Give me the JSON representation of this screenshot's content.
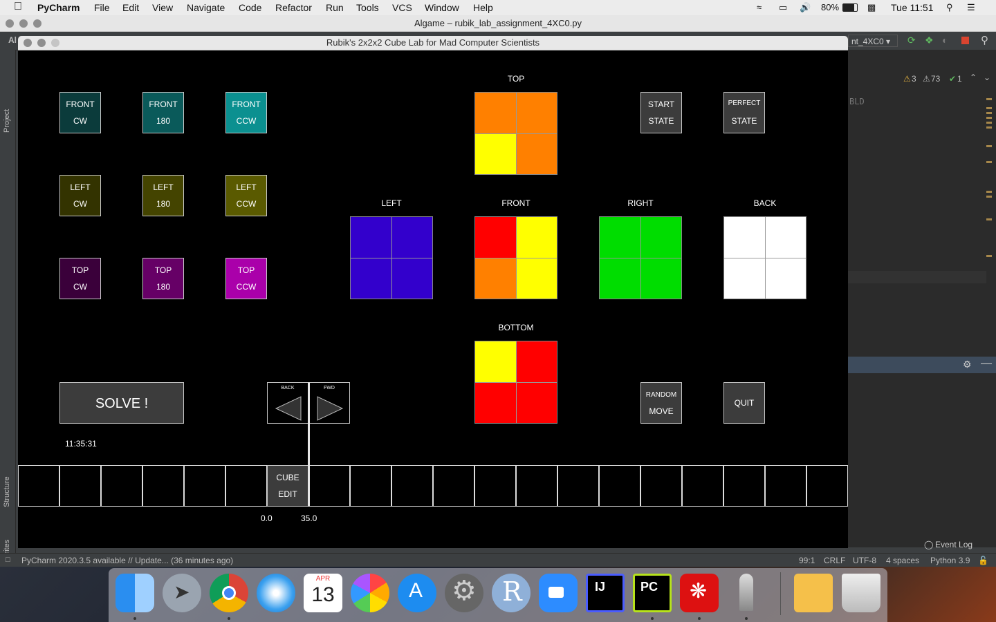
{
  "menubar": {
    "app": "PyCharm",
    "items": [
      "File",
      "Edit",
      "View",
      "Navigate",
      "Code",
      "Refactor",
      "Run",
      "Tools",
      "VCS",
      "Window",
      "Help"
    ],
    "battery": "80%",
    "clock": "Tue 11:51"
  },
  "ide": {
    "title": "Algame – rubik_lab_assignment_4XC0.py",
    "config": "nt_4XC0",
    "warnings": "3",
    "weak_warnings": "73",
    "ok": "1",
    "project_tab": "Project",
    "structure_tab": "Structure",
    "favorites_tab": "Favorites",
    "event_log": "Event Log",
    "editor_token": "BLD",
    "status_left": "PyCharm 2020.3.5 available // Update... (36 minutes ago)",
    "status_pos": "99:1",
    "status_eol": "CRLF",
    "status_enc": "UTF-8",
    "status_indent": "4 spaces",
    "status_py": "Python 3.9"
  },
  "window": {
    "title": "Rubik's 2x2x2 Cube Lab for Mad Computer Scientists"
  },
  "buttons": {
    "front_cw": [
      "FRONT",
      "CW"
    ],
    "front_180": [
      "FRONT",
      "180"
    ],
    "front_ccw": [
      "FRONT",
      "CCW"
    ],
    "left_cw": [
      "LEFT",
      "CW"
    ],
    "left_180": [
      "LEFT",
      "180"
    ],
    "left_ccw": [
      "LEFT",
      "CCW"
    ],
    "top_cw": [
      "TOP",
      "CW"
    ],
    "top_180": [
      "TOP",
      "180"
    ],
    "top_ccw": [
      "TOP",
      "CCW"
    ],
    "start_state": [
      "START",
      "STATE"
    ],
    "perfect_state": [
      "PERFECT",
      "STATE"
    ],
    "random_move": [
      "RANDOM",
      "MOVE"
    ],
    "quit": "QUIT",
    "solve": "SOLVE !",
    "back": "BACK",
    "fwd": "FWD",
    "cube_edit": [
      "CUBE",
      "EDIT"
    ]
  },
  "faces": {
    "top": {
      "label": "TOP",
      "colors": [
        "#ff8000",
        "#ff8000",
        "#ffff00",
        "#ff8000"
      ]
    },
    "left": {
      "label": "LEFT",
      "colors": [
        "#3300cc",
        "#3300cc",
        "#3300cc",
        "#3300cc"
      ]
    },
    "front": {
      "label": "FRONT",
      "colors": [
        "#ff0000",
        "#ffff00",
        "#ff8000",
        "#ffff00"
      ]
    },
    "right": {
      "label": "RIGHT",
      "colors": [
        "#00dd00",
        "#00dd00",
        "#00dd00",
        "#00dd00"
      ]
    },
    "back": {
      "label": "BACK",
      "colors": [
        "#ffffff",
        "#ffffff",
        "#ffffff",
        "#ffffff"
      ]
    },
    "bottom": {
      "label": "BOTTOM",
      "colors": [
        "#ffff00",
        "#ff0000",
        "#ff0000",
        "#ff0000"
      ]
    }
  },
  "timer": "11:35:31",
  "timeline": {
    "start": "0.0",
    "end": "35.0",
    "slots": 20
  },
  "colors": {
    "front_buttons": [
      "#0b3b3b",
      "#0a5a5a",
      "#0b9090"
    ],
    "left_buttons": [
      "#333300",
      "#444400",
      "#5a5a00"
    ],
    "top_buttons": [
      "#3a003a",
      "#660066",
      "#aa00aa"
    ],
    "gray_button": "#3c3c3c"
  },
  "dock_icons": [
    "finder-icon",
    "launchpad-icon",
    "chrome-icon",
    "safari-icon",
    "calendar-icon",
    "photos-icon",
    "app-store-icon",
    "system-preferences-icon",
    "r-icon",
    "zoom-icon",
    "intellij-icon",
    "pycharm-icon",
    "acrobat-icon",
    "python-launcher-icon",
    "archive-icon",
    "trash-icon"
  ],
  "calendar": {
    "month": "APR",
    "day": "13"
  }
}
